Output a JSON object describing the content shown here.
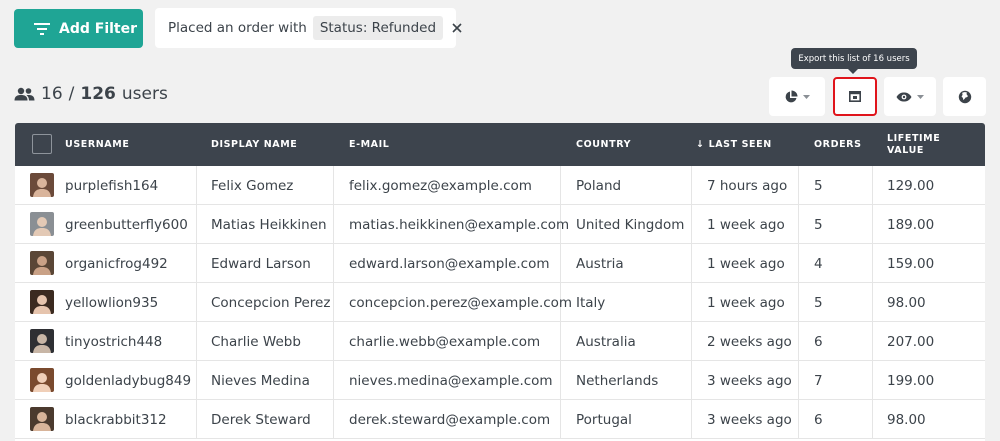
{
  "toolbar": {
    "add_filter_label": "Add Filter",
    "filter_prefix": "Placed an order with",
    "filter_status": "Status: Refunded",
    "export_tooltip": "Export this list of 16 users"
  },
  "summary": {
    "count": "16",
    "slash": "/",
    "total": "126",
    "label": "users"
  },
  "table": {
    "headers": {
      "username": "USERNAME",
      "display_name": "DISPLAY NAME",
      "email": "E-MAIL",
      "country": "COUNTRY",
      "sort_arrow": "↓",
      "last_seen": "LAST SEEN",
      "orders": "ORDERS",
      "lifetime_1": "LIFETIME",
      "lifetime_2": "VALUE"
    },
    "rows": [
      {
        "username": "purplefish164",
        "display_name": "Felix Gomez",
        "email": "felix.gomez@example.com",
        "country": "Poland",
        "last_seen": "7 hours ago",
        "orders": "5",
        "lifetime_value": "129.00"
      },
      {
        "username": "greenbutterfly600",
        "display_name": "Matias Heikkinen",
        "email": "matias.heikkinen@example.com",
        "country": "United Kingdom",
        "last_seen": "1 week ago",
        "orders": "5",
        "lifetime_value": "189.00"
      },
      {
        "username": "organicfrog492",
        "display_name": "Edward Larson",
        "email": "edward.larson@example.com",
        "country": "Austria",
        "last_seen": "1 week ago",
        "orders": "4",
        "lifetime_value": "159.00"
      },
      {
        "username": "yellowlion935",
        "display_name": "Concepcion Perez",
        "email": "concepcion.perez@example.com",
        "country": "Italy",
        "last_seen": "1 week ago",
        "orders": "5",
        "lifetime_value": "98.00"
      },
      {
        "username": "tinyostrich448",
        "display_name": "Charlie Webb",
        "email": "charlie.webb@example.com",
        "country": "Australia",
        "last_seen": "2 weeks ago",
        "orders": "6",
        "lifetime_value": "207.00"
      },
      {
        "username": "goldenladybug849",
        "display_name": "Nieves Medina",
        "email": "nieves.medina@example.com",
        "country": "Netherlands",
        "last_seen": "3 weeks ago",
        "orders": "7",
        "lifetime_value": "199.00"
      },
      {
        "username": "blackrabbit312",
        "display_name": "Derek Steward",
        "email": "derek.steward@example.com",
        "country": "Portugal",
        "last_seen": "3 weeks ago",
        "orders": "6",
        "lifetime_value": "98.00"
      }
    ]
  },
  "colors": {
    "accent": "#1fa595",
    "header_bg": "#3d444d",
    "highlight": "#e0141b",
    "background": "#f1f1f1"
  },
  "icons": {
    "add_filter": "filter-lines-icon",
    "close": "close-icon",
    "users": "users-icon",
    "segment": "pie-chart-icon",
    "export": "export-icon",
    "columns": "eye-icon",
    "globe": "globe-icon",
    "caret": "caret-down-icon"
  }
}
